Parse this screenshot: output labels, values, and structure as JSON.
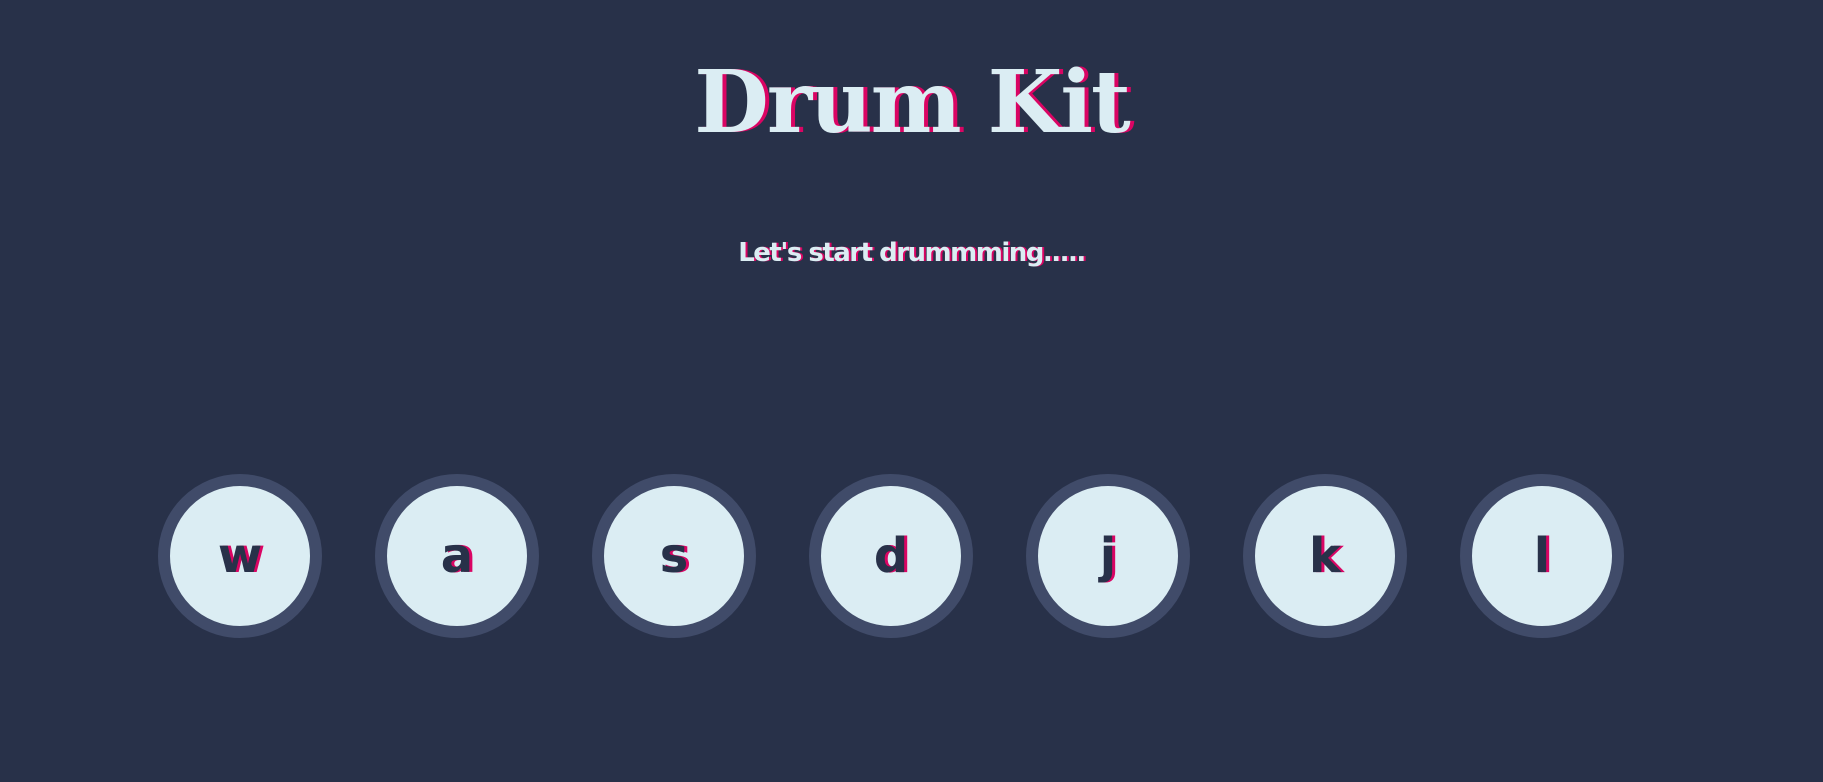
{
  "header": {
    "title": "Drum Kit",
    "subtitle": "Let's start drummming....."
  },
  "drums": [
    {
      "key": "w"
    },
    {
      "key": "a"
    },
    {
      "key": "s"
    },
    {
      "key": "d"
    },
    {
      "key": "j"
    },
    {
      "key": "k"
    },
    {
      "key": "l"
    }
  ],
  "colors": {
    "background": "#283149",
    "drum_face": "#dbedf3",
    "drum_rim": "#404b69",
    "accent_shadow": "#da0463",
    "text_light": "#dbedf3"
  }
}
